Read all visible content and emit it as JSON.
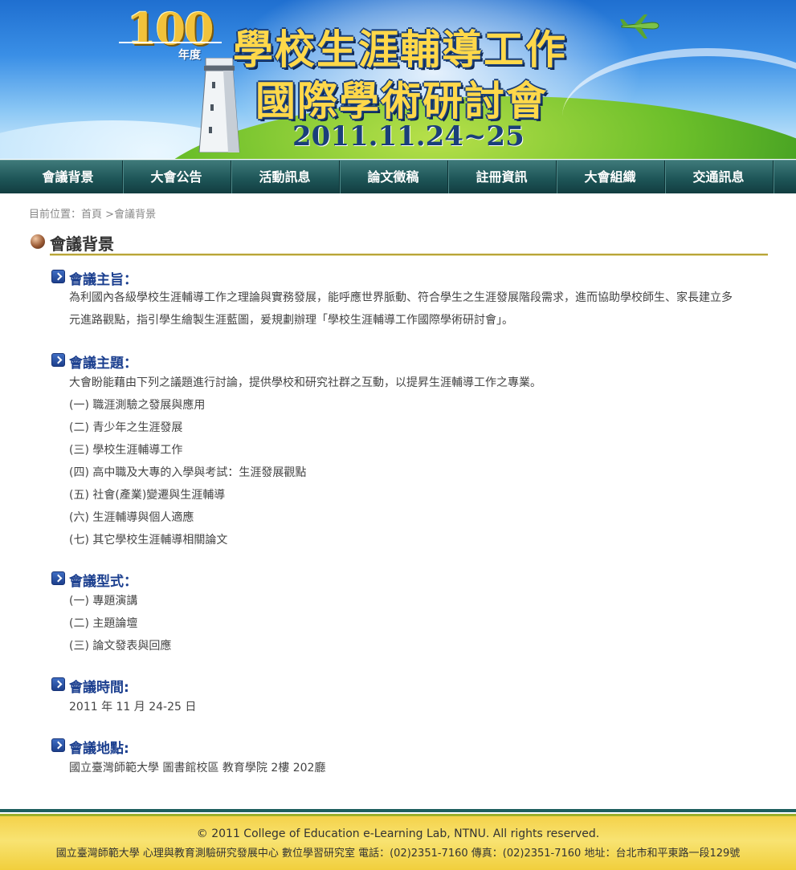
{
  "banner": {
    "year_number": "100",
    "year_suffix": "年度",
    "title_line1": "學校生涯輔導工作",
    "title_line2": "國際學術研討會",
    "dates": "2011.11.24~25"
  },
  "nav": {
    "items": [
      "會議背景",
      "大會公告",
      "活動訊息",
      "論文徵稿",
      "註冊資訊",
      "大會組織",
      "交通訊息"
    ]
  },
  "breadcrumb": {
    "prefix": "目前位置：",
    "home": "首頁",
    "separator": " >",
    "current": "會議背景"
  },
  "page_title": "會議背景",
  "sections": {
    "purpose": {
      "title": "會議主旨：",
      "text": "為利國內各級學校生涯輔導工作之理論與實務發展，能呼應世界脈動、符合學生之生涯發展階段需求，進而協助學校師生、家長建立多元進路觀點，指引學生繪製生涯藍圖，爰規劃辦理「學校生涯輔導工作國際學術研討會」。"
    },
    "themes": {
      "title": "會議主題：",
      "intro": "大會盼能藉由下列之議題進行討論，提供學校和研究社群之互動，以提昇生涯輔導工作之專業。",
      "items": [
        "(一) 職涯測驗之發展與應用",
        "(二) 青少年之生涯發展",
        "(三) 學校生涯輔導工作",
        "(四) 高中職及大專的入學與考試：生涯發展觀點",
        "(五) 社會(產業)變遷與生涯輔導",
        "(六) 生涯輔導與個人適應",
        "(七) 其它學校生涯輔導相關論文"
      ]
    },
    "format": {
      "title": "會議型式：",
      "items": [
        "(一) 專題演講",
        "(二) 主題論壇",
        "(三) 論文發表與回應"
      ]
    },
    "time": {
      "title": "會議時間:",
      "text": "2011 年 11 月 24-25 日"
    },
    "location": {
      "title": "會議地點:",
      "text": "國立臺灣師範大學 圖書館校區 教育學院 2樓 202廳"
    }
  },
  "footer": {
    "copyright": "© 2011 College of Education e-Learning Lab, NTNU. All rights reserved.",
    "address": "國立臺灣師範大學 心理與教育測驗研究發展中心 數位學習研究室 電話：(02)2351-7160 傳真：(02)2351-7160 地址：台北市和平東路一段129號"
  },
  "colors": {
    "nav_bg": "#1e5658",
    "section_title": "#1b3f8f",
    "title_rule": "#b9a53a",
    "footer_bg": "#f4d24a"
  }
}
